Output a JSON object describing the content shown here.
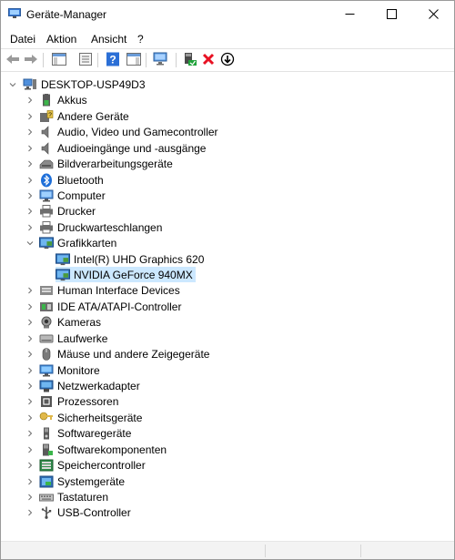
{
  "window": {
    "title": "Geräte-Manager",
    "controls": {
      "minimize": "minimize-icon",
      "maximize": "maximize-icon",
      "close": "close-icon"
    }
  },
  "menu": [
    "Datei",
    "Aktion",
    "Ansicht",
    "?"
  ],
  "toolbar": {
    "buttons": [
      "back-arrow-icon",
      "forward-arrow-icon",
      "show-hide-console-tree-icon",
      "properties-icon",
      "help-icon",
      "action-pane-icon",
      "scan-hardware-icon",
      "update-driver-icon",
      "uninstall-device-icon",
      "disable-device-icon"
    ],
    "colors": {
      "help": "#2b6fd6",
      "uninstall": "#e81123",
      "green": "#21a33b"
    }
  },
  "tree": {
    "root": "DESKTOP-USP49D3",
    "categories": [
      {
        "label": "Akkus",
        "icon": "battery-icon"
      },
      {
        "label": "Andere Geräte",
        "icon": "unknown-device-icon"
      },
      {
        "label": "Audio, Video und Gamecontroller",
        "icon": "speaker-icon"
      },
      {
        "label": "Audioeingänge und -ausgänge",
        "icon": "speaker-icon"
      },
      {
        "label": "Bildverarbeitungsgeräte",
        "icon": "camera-imaging-icon"
      },
      {
        "label": "Bluetooth",
        "icon": "bluetooth-icon"
      },
      {
        "label": "Computer",
        "icon": "computer-icon"
      },
      {
        "label": "Drucker",
        "icon": "printer-icon"
      },
      {
        "label": "Druckwarteschlangen",
        "icon": "printer-icon"
      },
      {
        "label": "Grafikkarten",
        "icon": "display-adapter-icon",
        "expanded": true,
        "children": [
          {
            "label": "Intel(R) UHD Graphics 620",
            "icon": "display-adapter-icon"
          },
          {
            "label": "NVIDIA GeForce 940MX",
            "icon": "display-adapter-icon",
            "selected": true
          }
        ]
      },
      {
        "label": "Human Interface Devices",
        "icon": "hid-icon"
      },
      {
        "label": "IDE ATA/ATAPI-Controller",
        "icon": "ide-controller-icon"
      },
      {
        "label": "Kameras",
        "icon": "webcam-icon"
      },
      {
        "label": "Laufwerke",
        "icon": "disk-drive-icon"
      },
      {
        "label": "Mäuse und andere Zeigegeräte",
        "icon": "mouse-icon"
      },
      {
        "label": "Monitore",
        "icon": "monitor-icon"
      },
      {
        "label": "Netzwerkadapter",
        "icon": "network-adapter-icon"
      },
      {
        "label": "Prozessoren",
        "icon": "processor-icon"
      },
      {
        "label": "Sicherheitsgeräte",
        "icon": "security-key-icon"
      },
      {
        "label": "Softwaregeräte",
        "icon": "software-device-icon"
      },
      {
        "label": "Softwarekomponenten",
        "icon": "software-component-icon"
      },
      {
        "label": "Speichercontroller",
        "icon": "storage-controller-icon"
      },
      {
        "label": "Systemgeräte",
        "icon": "system-device-icon"
      },
      {
        "label": "Tastaturen",
        "icon": "keyboard-icon"
      },
      {
        "label": "USB-Controller",
        "icon": "usb-icon"
      }
    ]
  }
}
